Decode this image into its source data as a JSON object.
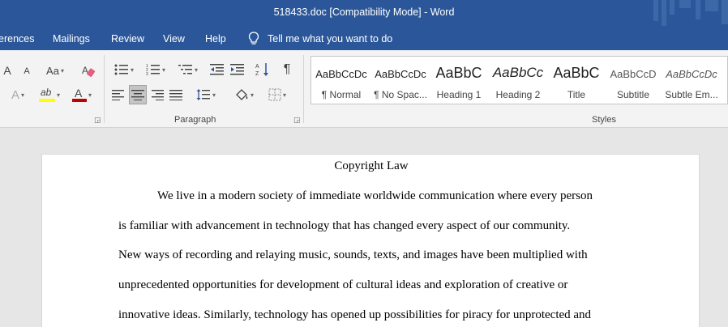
{
  "window": {
    "title": "518433.doc [Compatibility Mode]  -  Word"
  },
  "tabs": [
    "erences",
    "Mailings",
    "Review",
    "View",
    "Help"
  ],
  "tell_me": "Tell me what you want to do",
  "ribbon": {
    "paragraph_label": "Paragraph",
    "styles_label": "Styles",
    "font_tools": {
      "grow": "A",
      "shrink": "A",
      "case": "Aa",
      "effects": "A",
      "highlight": "ab",
      "font_color": "A"
    },
    "styles": [
      {
        "preview": "AaBbCcDc",
        "name": "¶ Normal"
      },
      {
        "preview": "AaBbCcDc",
        "name": "¶ No Spac..."
      },
      {
        "preview": "AaBbC",
        "name": "Heading 1"
      },
      {
        "preview": "AaBbCc",
        "name": "Heading 2"
      },
      {
        "preview": "AaBbC",
        "name": "Title"
      },
      {
        "preview": "AaBbCcD",
        "name": "Subtitle"
      },
      {
        "preview": "AaBbCcDc",
        "name": "Subtle Em..."
      }
    ]
  },
  "colors": {
    "accent": "#2b579a",
    "highlight": "#ffff00",
    "font_color": "#c00000"
  },
  "document": {
    "title": "Copyright Law",
    "lines": [
      "We live in a modern society of immediate worldwide communication where every person",
      "is familiar with advancement in technology that has changed every aspect of our community.",
      "New ways of recording and relaying music, sounds, texts, and images have been multiplied with",
      "unprecedented opportunities for development of cultural ideas and exploration of creative or",
      "innovative ideas. Similarly, technology has opened up possibilities for piracy for unprotected and"
    ]
  }
}
